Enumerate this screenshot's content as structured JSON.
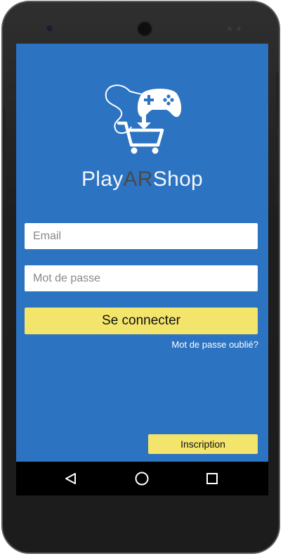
{
  "app": {
    "title_part1": "Play",
    "title_part2": "AR",
    "title_part3": "Shop"
  },
  "login": {
    "email_placeholder": "Email",
    "password_placeholder": "Mot de passe",
    "connect_label": "Se connecter",
    "forgot_label": "Mot de passe oublié?",
    "signup_label": "Inscription"
  },
  "navbar": {
    "back_icon": "back-triangle",
    "home_icon": "home-circle",
    "recents_icon": "recents-square"
  },
  "colors": {
    "screen_bg": "#2c73c2",
    "button_yellow": "#f3e56c",
    "title_white": "#f4f6fa",
    "title_ar": "#4a4a4a"
  }
}
